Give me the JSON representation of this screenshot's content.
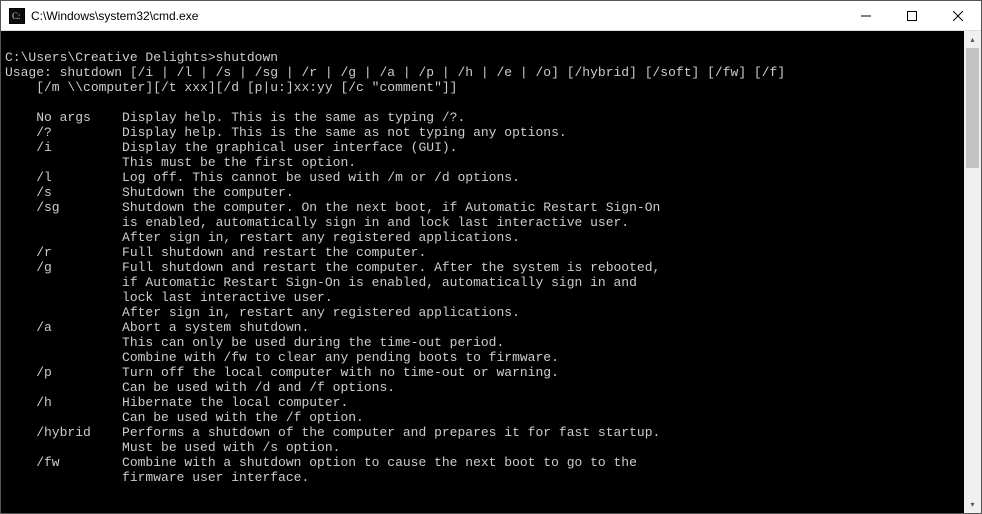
{
  "titlebar": {
    "title": "C:\\Windows\\system32\\cmd.exe",
    "minimize": "—",
    "maximize": "▢",
    "close": "✕"
  },
  "scrollbar": {
    "up": "▴",
    "down": "▾"
  },
  "terminal": {
    "lines": [
      "",
      "C:\\Users\\Creative Delights>shutdown",
      "Usage: shutdown [/i | /l | /s | /sg | /r | /g | /a | /p | /h | /e | /o] [/hybrid] [/soft] [/fw] [/f]",
      "    [/m \\\\computer][/t xxx][/d [p|u:]xx:yy [/c \"comment\"]]",
      "",
      "    No args    Display help. This is the same as typing /?.",
      "    /?         Display help. This is the same as not typing any options.",
      "    /i         Display the graphical user interface (GUI).",
      "               This must be the first option.",
      "    /l         Log off. This cannot be used with /m or /d options.",
      "    /s         Shutdown the computer.",
      "    /sg        Shutdown the computer. On the next boot, if Automatic Restart Sign-On",
      "               is enabled, automatically sign in and lock last interactive user.",
      "               After sign in, restart any registered applications.",
      "    /r         Full shutdown and restart the computer.",
      "    /g         Full shutdown and restart the computer. After the system is rebooted,",
      "               if Automatic Restart Sign-On is enabled, automatically sign in and",
      "               lock last interactive user.",
      "               After sign in, restart any registered applications.",
      "    /a         Abort a system shutdown.",
      "               This can only be used during the time-out period.",
      "               Combine with /fw to clear any pending boots to firmware.",
      "    /p         Turn off the local computer with no time-out or warning.",
      "               Can be used with /d and /f options.",
      "    /h         Hibernate the local computer.",
      "               Can be used with the /f option.",
      "    /hybrid    Performs a shutdown of the computer and prepares it for fast startup.",
      "               Must be used with /s option.",
      "    /fw        Combine with a shutdown option to cause the next boot to go to the",
      "               firmware user interface."
    ]
  }
}
